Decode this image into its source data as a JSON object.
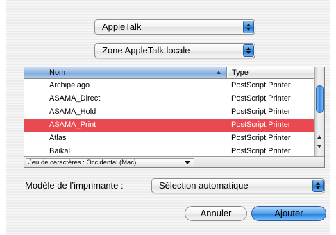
{
  "popups": {
    "protocol": "AppleTalk",
    "zone": "Zone AppleTalk locale",
    "model": "Sélection automatique"
  },
  "list": {
    "columns": [
      "Nom",
      "Type"
    ],
    "sort_column": "Nom",
    "rows": [
      {
        "name": "Archipelago",
        "type": "PostScript Printer",
        "selected": false
      },
      {
        "name": "ASAMA_Direct",
        "type": "PostScript Printer",
        "selected": false
      },
      {
        "name": "ASAMA_Hold",
        "type": "PostScript Printer",
        "selected": false
      },
      {
        "name": "ASAMA_Print",
        "type": "PostScript Printer",
        "selected": true
      },
      {
        "name": "Atlas",
        "type": "PostScript Printer",
        "selected": false
      },
      {
        "name": "Baikal",
        "type": "PostScript Printer",
        "selected": false
      }
    ],
    "charset_label": "Jeu de caractères : Occidental (Mac)"
  },
  "model_label": "Modèle de l’imprimante :",
  "buttons": {
    "cancel": "Annuler",
    "add": "Ajouter"
  },
  "colors": {
    "selection": "#e94a52",
    "accent": "#3a86d8"
  }
}
